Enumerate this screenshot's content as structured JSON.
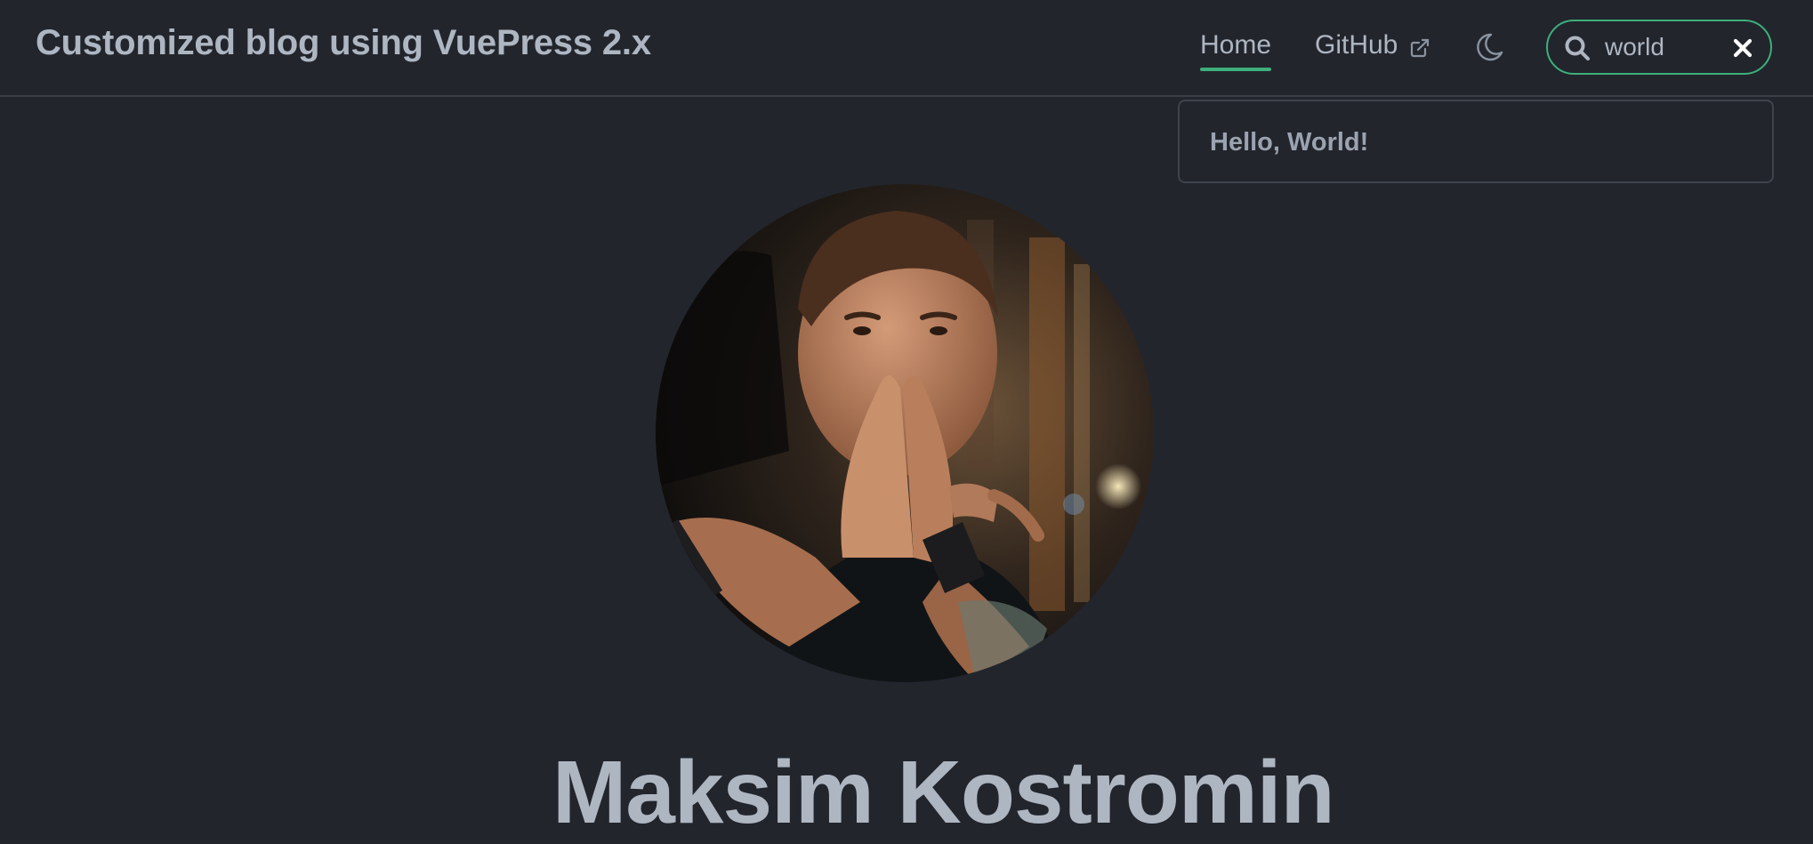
{
  "navbar": {
    "site_title": "Customized blog using VuePress 2.x",
    "links": {
      "home": "Home",
      "github": "GitHub"
    },
    "accent_color": "#3eaf7c",
    "theme_toggle_icon": "moon-icon",
    "external_link_icon": "external-link-icon"
  },
  "search": {
    "value": "world",
    "search_icon": "search-icon",
    "clear_icon": "close-icon",
    "suggestions": [
      {
        "title": "Hello, World!"
      }
    ]
  },
  "hero": {
    "avatar": "author-photo",
    "name": "Maksim Kostromin"
  }
}
